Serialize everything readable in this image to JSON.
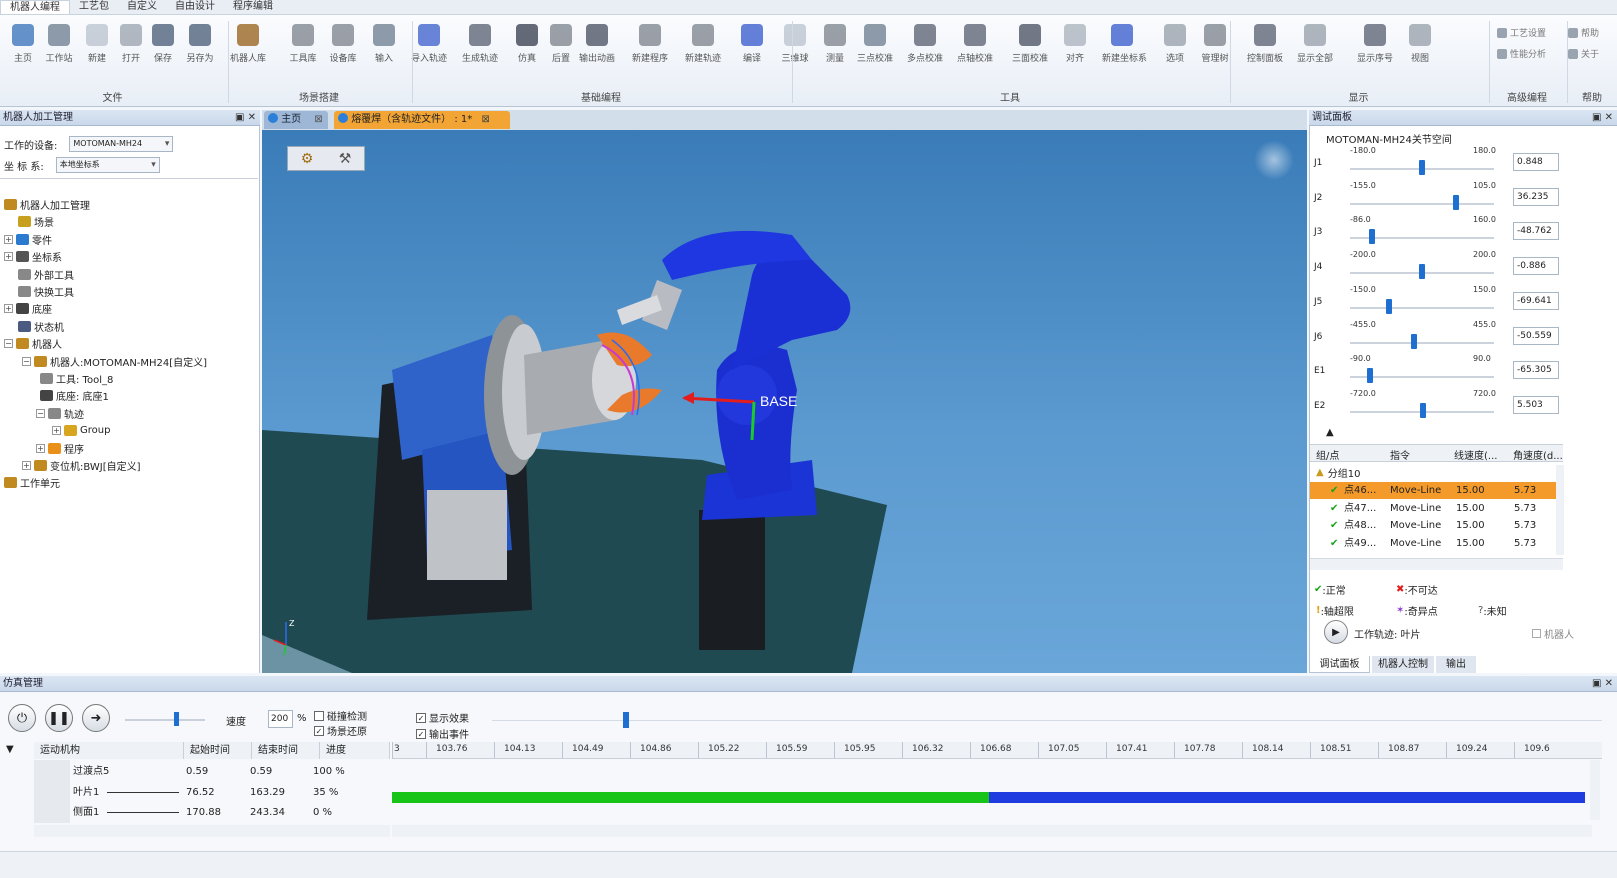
{
  "menubar": {
    "tabs": [
      "机器人编程",
      "工艺包",
      "自定义",
      "自由设计",
      "程序编辑"
    ],
    "active_index": 0
  },
  "ribbon": {
    "buttons": [
      {
        "label": "主页",
        "icon": "home-icon"
      },
      {
        "label": "工作站",
        "icon": "workstation-icon"
      },
      {
        "label": "新建",
        "icon": "new-file-icon"
      },
      {
        "label": "打开",
        "icon": "open-folder-icon"
      },
      {
        "label": "保存",
        "icon": "save-icon"
      },
      {
        "label": "另存为",
        "icon": "save-as-icon"
      },
      {
        "label": "机器人库",
        "icon": "robot-library-icon"
      },
      {
        "label": "工具库",
        "icon": "tool-library-icon"
      },
      {
        "label": "设备库",
        "icon": "device-library-icon"
      },
      {
        "label": "输入",
        "icon": "import-icon"
      },
      {
        "label": "导入轨迹",
        "icon": "import-path-icon"
      },
      {
        "label": "生成轨迹",
        "icon": "generate-path-icon"
      },
      {
        "label": "仿真",
        "icon": "simulation-icon"
      },
      {
        "label": "后置",
        "icon": "post-process-icon"
      },
      {
        "label": "输出动画",
        "icon": "export-animation-icon"
      },
      {
        "label": "新建程序",
        "icon": "new-program-icon"
      },
      {
        "label": "新建轨迹",
        "icon": "new-path-icon"
      },
      {
        "label": "编译",
        "icon": "compile-icon"
      },
      {
        "label": "三维球",
        "icon": "3d-ball-icon"
      },
      {
        "label": "测量",
        "icon": "measure-icon"
      },
      {
        "label": "三点校准",
        "icon": "three-point-calibration-icon"
      },
      {
        "label": "多点校准",
        "icon": "multi-point-calibration-icon"
      },
      {
        "label": "点轴校准",
        "icon": "point-axis-calibration-icon"
      },
      {
        "label": "三面校准",
        "icon": "three-face-calibration-icon"
      },
      {
        "label": "对齐",
        "icon": "align-icon"
      },
      {
        "label": "新建坐标系",
        "icon": "new-coordinate-icon"
      },
      {
        "label": "选项",
        "icon": "options-icon"
      },
      {
        "label": "管理树",
        "icon": "manage-tree-icon"
      },
      {
        "label": "控制面板",
        "icon": "control-panel-icon"
      },
      {
        "label": "显示全部",
        "icon": "show-all-icon"
      },
      {
        "label": "显示序号",
        "icon": "show-index-icon"
      },
      {
        "label": "视图",
        "icon": "view-icon"
      }
    ],
    "small": [
      "工艺设置",
      "性能分析",
      "帮助",
      "关于"
    ],
    "groups": [
      "文件",
      "场景搭建",
      "基础编程",
      "工具",
      "显示",
      "高级编程",
      "帮助"
    ]
  },
  "left": {
    "title": "机器人加工管理",
    "device_label": "工作的设备:",
    "device_value": "MOTOMAN-MH24",
    "coord_label": "坐  标  系:",
    "coord_value": "本地坐标系",
    "tree": [
      {
        "label": "机器人加工管理",
        "icon": "robot-icon"
      },
      {
        "label": "场景",
        "icon": "scene-icon"
      },
      {
        "label": "零件",
        "icon": "part-icon"
      },
      {
        "label": "坐标系",
        "icon": "coordinate-icon"
      },
      {
        "label": "外部工具",
        "icon": "tool-icon"
      },
      {
        "label": "快换工具",
        "icon": "quick-change-icon"
      },
      {
        "label": "底座",
        "icon": "base-icon"
      },
      {
        "label": "状态机",
        "icon": "state-machine-icon"
      },
      {
        "label": "机器人",
        "icon": "robot-icon"
      },
      {
        "label": "机器人:MOTOMAN-MH24[自定义]",
        "icon": "robot-icon"
      },
      {
        "label": "工具: Tool_8",
        "icon": "tool-icon"
      },
      {
        "label": "底座: 底座1",
        "icon": "base-icon"
      },
      {
        "label": "轨迹",
        "icon": "path-icon"
      },
      {
        "label": "Group",
        "icon": "folder-icon"
      },
      {
        "label": "程序",
        "icon": "program-icon"
      },
      {
        "label": "变位机:BWJ[自定义]",
        "icon": "positioner-icon"
      },
      {
        "label": "工作单元",
        "icon": "work-cell-icon"
      }
    ]
  },
  "center": {
    "tab_home": "主页",
    "tab_doc": "熔覆焊（含轨迹文件） : 1*",
    "base_label": "BASE",
    "axis_label": "Z"
  },
  "right": {
    "title": "调试面板",
    "subtitle": "MOTOMAN-MH24关节空间",
    "joints": [
      {
        "name": "J1",
        "min": "-180.0",
        "max": "180.0",
        "value": "0.848",
        "pos": 0.502
      },
      {
        "name": "J2",
        "min": "-155.0",
        "max": "105.0",
        "value": "36.235",
        "pos": 0.735
      },
      {
        "name": "J3",
        "min": "-86.0",
        "max": "160.0",
        "value": "-48.762",
        "pos": 0.152
      },
      {
        "name": "J4",
        "min": "-200.0",
        "max": "200.0",
        "value": "-0.886",
        "pos": 0.498
      },
      {
        "name": "J5",
        "min": "-150.0",
        "max": "150.0",
        "value": "-69.641",
        "pos": 0.268
      },
      {
        "name": "J6",
        "min": "-455.0",
        "max": "455.0",
        "value": "-50.559",
        "pos": 0.444
      },
      {
        "name": "E1",
        "min": "-90.0",
        "max": "90.0",
        "value": "-65.305",
        "pos": 0.137
      },
      {
        "name": "E2",
        "min": "-720.0",
        "max": "720.0",
        "value": "5.503",
        "pos": 0.504
      }
    ],
    "grid_headers": [
      "组/点",
      "指令",
      "线速度(...",
      "角速度(d..."
    ],
    "group_label": "分组10",
    "rows": [
      {
        "point": "点46...",
        "cmd": "Move-Line",
        "lin": "15.00",
        "ang": "5.73",
        "selected": true
      },
      {
        "point": "点47...",
        "cmd": "Move-Line",
        "lin": "15.00",
        "ang": "5.73",
        "selected": false
      },
      {
        "point": "点48...",
        "cmd": "Move-Line",
        "lin": "15.00",
        "ang": "5.73",
        "selected": false
      },
      {
        "point": "点49...",
        "cmd": "Move-Line",
        "lin": "15.00",
        "ang": "5.73",
        "selected": false
      }
    ],
    "legend": {
      "ok": ":正常",
      "unreach": ":不可达",
      "axis": ":轴超限",
      "singular": ":奇异点",
      "unknown": ":未知"
    },
    "work_path": "工作轨迹:  叶片",
    "robot_check": "机器人",
    "bottom_tabs": [
      "调试面板",
      "机器人控制",
      "输出"
    ]
  },
  "sim": {
    "title": "仿真管理",
    "speed_label": "速度",
    "speed_value": "200",
    "speed_unit": "%",
    "checks": [
      {
        "label": "碰撞检测",
        "checked": false
      },
      {
        "label": "场景还原",
        "checked": true
      },
      {
        "label": "显示效果",
        "checked": true
      },
      {
        "label": "输出事件",
        "checked": true
      }
    ],
    "headers": [
      "运动机构",
      "起始时间",
      "结束时间",
      "进度"
    ],
    "rows": [
      {
        "name": "过渡点5",
        "start": "0.59",
        "end": "0.59",
        "progress": "100 %"
      },
      {
        "name": "叶片1",
        "start": "76.52",
        "end": "163.29",
        "progress": "35 %"
      },
      {
        "name": "侧面1",
        "start": "170.88",
        "end": "243.34",
        "progress": "0 %"
      }
    ],
    "ticks": [
      "3",
      "103.76",
      "104.13",
      "104.49",
      "104.86",
      "105.22",
      "105.59",
      "105.95",
      "106.32",
      "106.68",
      "107.05",
      "107.41",
      "107.78",
      "108.14",
      "108.51",
      "108.87",
      "109.24",
      "109.6"
    ],
    "progress_fraction": 0.5,
    "colors": {
      "done": "#19c419",
      "todo": "#1f3ce0",
      "accent": "#1e6fd0",
      "selected": "#f39a2a"
    }
  }
}
